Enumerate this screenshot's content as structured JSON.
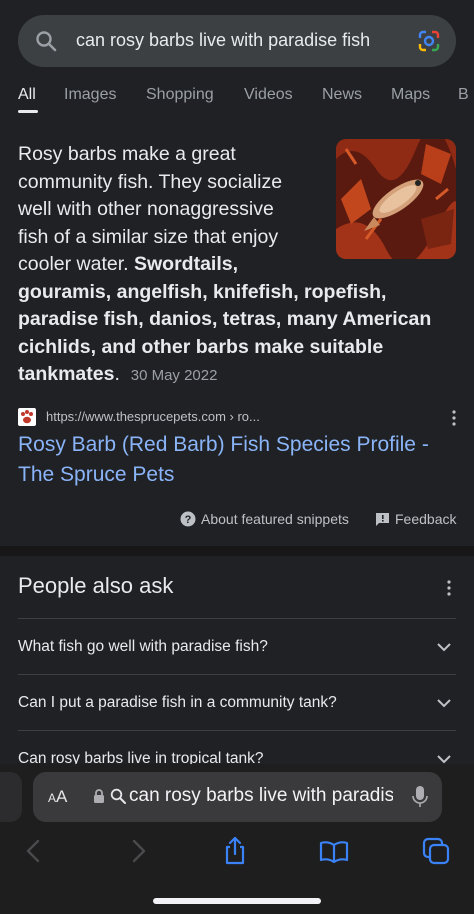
{
  "search": {
    "query": "can rosy barbs live with paradise fish"
  },
  "tabs": [
    {
      "label": "All",
      "active": true
    },
    {
      "label": "Images"
    },
    {
      "label": "Shopping"
    },
    {
      "label": "Videos"
    },
    {
      "label": "News"
    },
    {
      "label": "Maps"
    },
    {
      "label": "B"
    }
  ],
  "snippet": {
    "line1": "Rosy barbs make a great",
    "line2": "community fish. They socialize",
    "line3": "well with other nonaggressive",
    "line4": "fish of a similar size that enjoy",
    "line5_plain": "cooler water. ",
    "line5_bold": "Swordtails,",
    "bold_line6": "gouramis, angelfish, knifefish, ropefish,",
    "bold_line7": "paradise fish, danios, tetras, many American",
    "bold_line8": "cichlids, and other barbs make suitable",
    "bold_line9": "tankmates",
    "period": ".",
    "date": "30 May 2022"
  },
  "source": {
    "url": "https://www.thesprucepets.com › ro...",
    "title": "Rosy Barb (Red Barb) Fish Species Profile - The Spruce Pets"
  },
  "snippet_footer": {
    "about": "About featured snippets",
    "feedback": "Feedback"
  },
  "paa": {
    "title": "People also ask",
    "questions": [
      "What fish go well with paradise fish?",
      "Can I put a paradise fish in a community tank?",
      "Can rosy barbs live in tropical tank?"
    ]
  },
  "safari": {
    "aa_big": "A",
    "aa_small": "A",
    "address": "can rosy barbs live with paradise fish"
  },
  "colors": {
    "background": "#202124",
    "link": "#8ab4f8",
    "search_bar": "#3c4043"
  }
}
